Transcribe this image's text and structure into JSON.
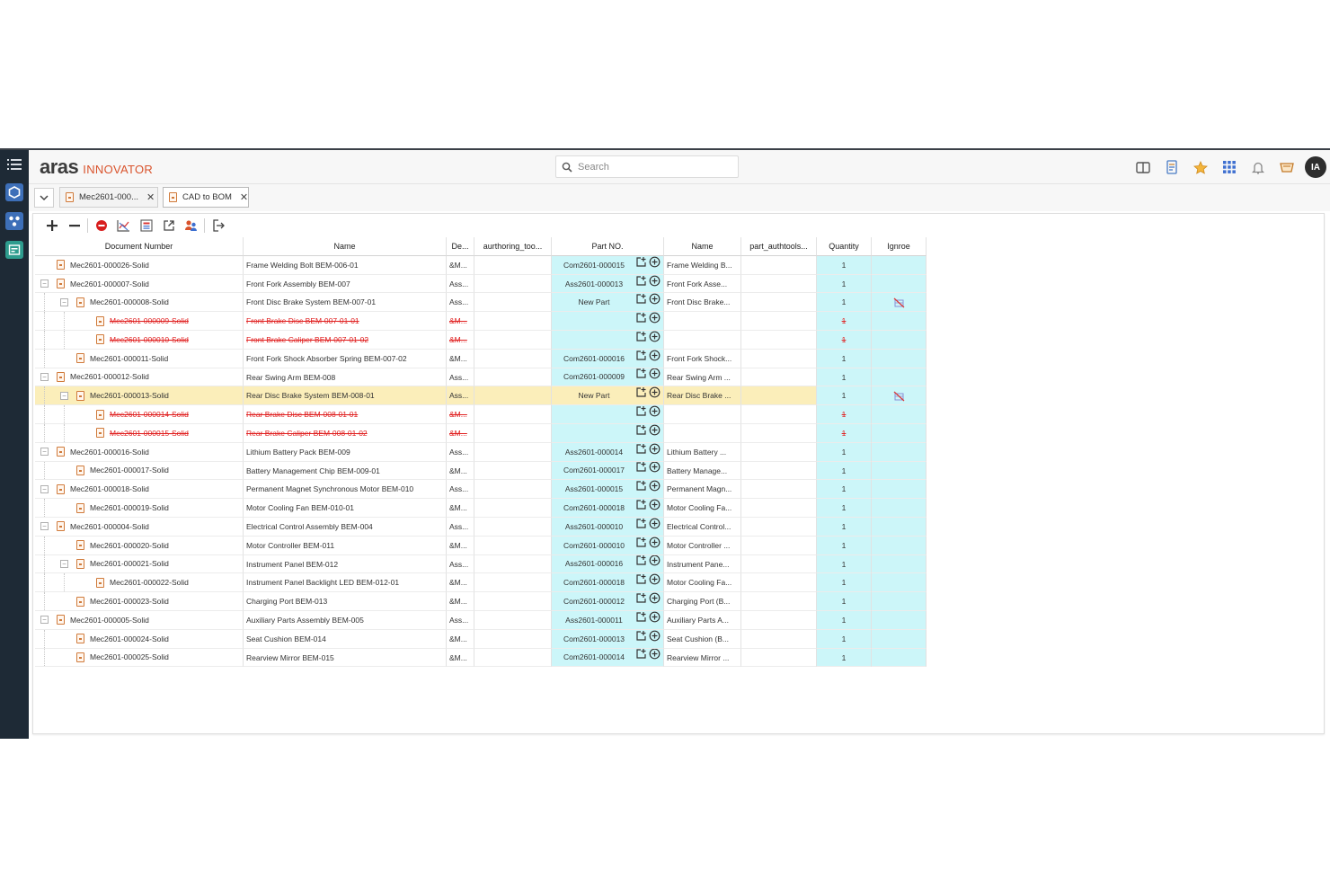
{
  "app": {
    "logo_main": "aras",
    "logo_sub": "INNOVATOR",
    "search_placeholder": "Search",
    "avatar": "IA",
    "accent_color": "#d9532c"
  },
  "tabs": [
    {
      "label": "Mec2601-000...",
      "active": false
    },
    {
      "label": "CAD to BOM",
      "active": true
    }
  ],
  "toolbar": {
    "icons": [
      "add-icon",
      "remove-icon",
      "stop-icon",
      "chart-icon",
      "grid-icon",
      "export-icon",
      "people-icon",
      "exit-icon"
    ]
  },
  "columns": [
    "Document Number",
    "Name",
    "De...",
    "aurthoring_too...",
    "Part NO.",
    "Name",
    "part_authtools...",
    "Quantity",
    "Ignroe"
  ],
  "rows": [
    {
      "level": 1,
      "expander": "none",
      "doc": "Mec2601-000026-Solid",
      "name": "Frame Welding Bolt BEM-006-01",
      "de": "&M...",
      "part": "Com2601-000015",
      "pname": "Frame Welding B...",
      "qty": "1",
      "ignore": false,
      "state": "normal"
    },
    {
      "level": 1,
      "expander": "minus",
      "doc": "Mec2601-000007-Solid",
      "name": "Front Fork Assembly BEM-007",
      "de": "Ass...",
      "part": "Ass2601-000013",
      "pname": "Front Fork Asse...",
      "qty": "1",
      "ignore": false,
      "state": "normal"
    },
    {
      "level": 2,
      "expander": "minus",
      "doc": "Mec2601-000008-Solid",
      "name": "Front Disc Brake System BEM-007-01",
      "de": "Ass...",
      "part": "New Part",
      "pname": "Front Disc Brake...",
      "qty": "1",
      "ignore": true,
      "state": "normal"
    },
    {
      "level": 3,
      "expander": "none",
      "doc": "Mec2601-000009-Solid",
      "name": "Front Brake Disc BEM-007-01-01",
      "de": "&M...",
      "part": "",
      "pname": "",
      "qty": "1",
      "ignore": false,
      "state": "struck"
    },
    {
      "level": 3,
      "expander": "none",
      "doc": "Mec2601-000010-Solid",
      "name": "Front Brake Caliper BEM-007-01-02",
      "de": "&M...",
      "part": "",
      "pname": "",
      "qty": "1",
      "ignore": false,
      "state": "struck"
    },
    {
      "level": 2,
      "expander": "none",
      "doc": "Mec2601-000011-Solid",
      "name": "Front Fork Shock Absorber Spring BEM-007-02",
      "de": "&M...",
      "part": "Com2601-000016",
      "pname": "Front Fork Shock...",
      "qty": "1",
      "ignore": false,
      "state": "normal"
    },
    {
      "level": 1,
      "expander": "minus",
      "doc": "Mec2601-000012-Solid",
      "name": "Rear Swing Arm BEM-008",
      "de": "Ass...",
      "part": "Com2601-000009",
      "pname": "Rear Swing Arm ...",
      "qty": "1",
      "ignore": false,
      "state": "normal"
    },
    {
      "level": 2,
      "expander": "minus",
      "doc": "Mec2601-000013-Solid",
      "name": "Rear Disc Brake System BEM-008-01",
      "de": "Ass...",
      "part": "New Part",
      "pname": "Rear Disc Brake ...",
      "qty": "1",
      "ignore": true,
      "state": "selected"
    },
    {
      "level": 3,
      "expander": "none",
      "doc": "Mec2601-000014-Solid",
      "name": "Rear Brake Disc BEM-008-01-01",
      "de": "&M...",
      "part": "",
      "pname": "",
      "qty": "1",
      "ignore": false,
      "state": "struck"
    },
    {
      "level": 3,
      "expander": "none",
      "doc": "Mec2601-000015-Solid",
      "name": "Rear Brake Caliper BEM-008-01-02",
      "de": "&M...",
      "part": "",
      "pname": "",
      "qty": "1",
      "ignore": false,
      "state": "struck"
    },
    {
      "level": 1,
      "expander": "minus",
      "doc": "Mec2601-000016-Solid",
      "name": "Lithium Battery Pack BEM-009",
      "de": "Ass...",
      "part": "Ass2601-000014",
      "pname": "Lithium Battery ...",
      "qty": "1",
      "ignore": false,
      "state": "normal"
    },
    {
      "level": 2,
      "expander": "none",
      "doc": "Mec2601-000017-Solid",
      "name": "Battery Management Chip BEM-009-01",
      "de": "&M...",
      "part": "Com2601-000017",
      "pname": "Battery Manage...",
      "qty": "1",
      "ignore": false,
      "state": "normal"
    },
    {
      "level": 1,
      "expander": "minus",
      "doc": "Mec2601-000018-Solid",
      "name": "Permanent Magnet Synchronous Motor BEM-010",
      "de": "Ass...",
      "part": "Ass2601-000015",
      "pname": "Permanent Magn...",
      "qty": "1",
      "ignore": false,
      "state": "normal"
    },
    {
      "level": 2,
      "expander": "none",
      "doc": "Mec2601-000019-Solid",
      "name": "Motor Cooling Fan BEM-010-01",
      "de": "&M...",
      "part": "Com2601-000018",
      "pname": "Motor Cooling Fa...",
      "qty": "1",
      "ignore": false,
      "state": "normal"
    },
    {
      "level": 1,
      "expander": "minus",
      "doc": "Mec2601-000004-Solid",
      "name": "Electrical Control Assembly BEM-004",
      "de": "Ass...",
      "part": "Ass2601-000010",
      "pname": "Electrical Control...",
      "qty": "1",
      "ignore": false,
      "state": "normal"
    },
    {
      "level": 2,
      "expander": "none",
      "doc": "Mec2601-000020-Solid",
      "name": "Motor Controller BEM-011",
      "de": "&M...",
      "part": "Com2601-000010",
      "pname": "Motor Controller ...",
      "qty": "1",
      "ignore": false,
      "state": "normal"
    },
    {
      "level": 2,
      "expander": "minus",
      "doc": "Mec2601-000021-Solid",
      "name": "Instrument Panel BEM-012",
      "de": "Ass...",
      "part": "Ass2601-000016",
      "pname": "Instrument Pane...",
      "qty": "1",
      "ignore": false,
      "state": "normal"
    },
    {
      "level": 3,
      "expander": "none",
      "doc": "Mec2601-000022-Solid",
      "name": "Instrument Panel Backlight LED BEM-012-01",
      "de": "&M...",
      "part": "Com2601-000018",
      "pname": "Motor Cooling Fa...",
      "qty": "1",
      "ignore": false,
      "state": "normal"
    },
    {
      "level": 2,
      "expander": "none",
      "doc": "Mec2601-000023-Solid",
      "name": "Charging Port BEM-013",
      "de": "&M...",
      "part": "Com2601-000012",
      "pname": "Charging Port (B...",
      "qty": "1",
      "ignore": false,
      "state": "normal"
    },
    {
      "level": 1,
      "expander": "minus",
      "doc": "Mec2601-000005-Solid",
      "name": "Auxiliary Parts Assembly BEM-005",
      "de": "Ass...",
      "part": "Ass2601-000011",
      "pname": "Auxiliary Parts A...",
      "qty": "1",
      "ignore": false,
      "state": "normal"
    },
    {
      "level": 2,
      "expander": "none",
      "doc": "Mec2601-000024-Solid",
      "name": "Seat Cushion BEM-014",
      "de": "&M...",
      "part": "Com2601-000013",
      "pname": "Seat Cushion (B...",
      "qty": "1",
      "ignore": false,
      "state": "normal"
    },
    {
      "level": 2,
      "expander": "none",
      "doc": "Mec2601-000025-Solid",
      "name": "Rearview Mirror BEM-015",
      "de": "&M...",
      "part": "Com2601-000014",
      "pname": "Rearview Mirror ...",
      "qty": "1",
      "ignore": false,
      "state": "normal"
    }
  ]
}
